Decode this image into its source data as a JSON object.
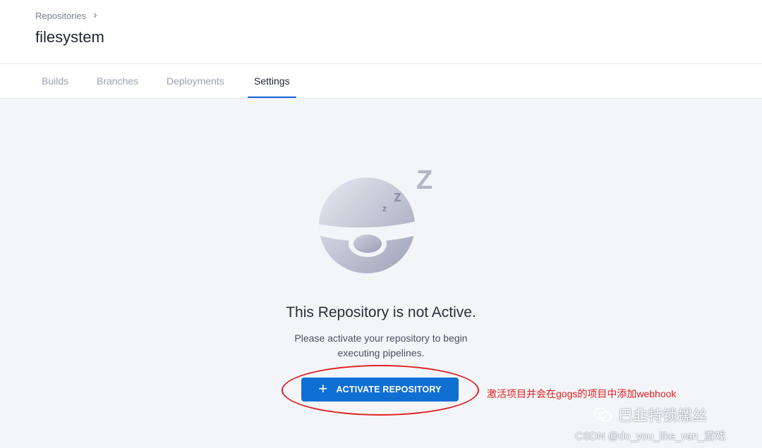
{
  "header": {
    "breadcrumb": "Repositories",
    "title": "filesystem"
  },
  "tabs": [
    {
      "label": "Builds"
    },
    {
      "label": "Branches"
    },
    {
      "label": "Deployments"
    },
    {
      "label": "Settings"
    }
  ],
  "active_tab": "Settings",
  "empty_state": {
    "title": "This Repository is not Active.",
    "description_line1": "Please activate your repository to begin",
    "description_line2": "executing pipelines.",
    "button_label": "ACTIVATE REPOSITORY",
    "zzz_large": "Z",
    "zzz_medium": "z",
    "zzz_small": "z"
  },
  "annotation": {
    "text": "激活项目并会在gogs的项目中添加webhook",
    "color": "#e02020"
  },
  "watermark": {
    "brand": "巴韭特锁螺丝",
    "credit": "CSDN @do_you_like_van_游戏"
  },
  "colors": {
    "accent": "#0f6fd3",
    "annotation": "#e02020"
  }
}
